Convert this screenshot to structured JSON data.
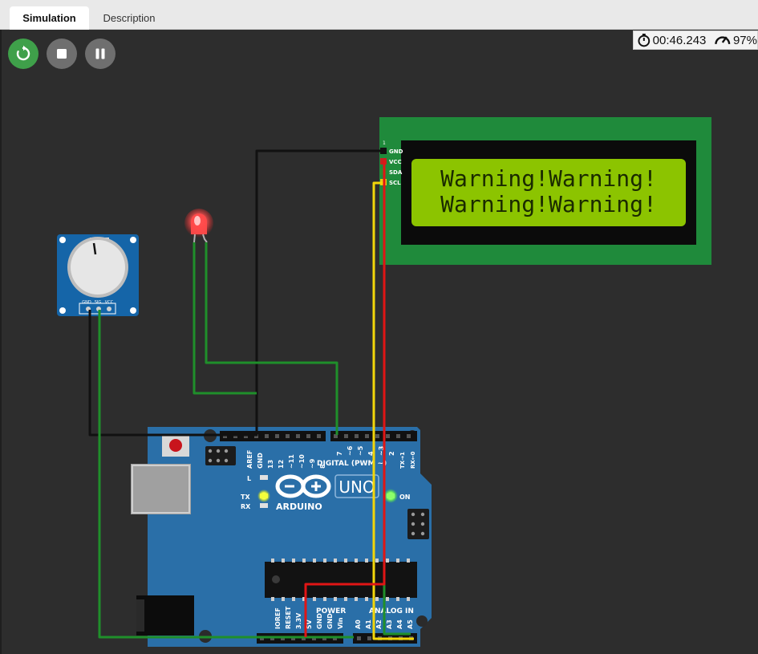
{
  "tabs": [
    {
      "label": "Simulation",
      "active": true
    },
    {
      "label": "Description",
      "active": false
    }
  ],
  "controls": {
    "restart": "restart-icon",
    "stop": "stop-icon",
    "pause": "pause-icon"
  },
  "status": {
    "elapsed_time": "00:46.243",
    "speed": "97%"
  },
  "lcd": {
    "line1": "Warning!Warning!",
    "line2": "Warning!Warning!",
    "pins": [
      "1",
      "GND",
      "VCC",
      "SDA",
      "SCL"
    ],
    "background": "#8cc400",
    "board_color": "#1f8a3b"
  },
  "potentiometer": {
    "pins": [
      "GND",
      "SIG",
      "VCC"
    ],
    "board_color": "#1565a8"
  },
  "led": {
    "color": "#ff3b3b"
  },
  "arduino": {
    "model": "UNO",
    "brand": "ARDUINO",
    "on_label": "ON",
    "l_label": "L",
    "tx_label": "TX",
    "rx_label": "RX",
    "digital_label": "DIGITAL (PWM ~)",
    "digital_pins": [
      "AREF",
      "GND",
      "13",
      "12",
      "~11",
      "~10",
      "~9",
      "8",
      "7",
      "~6",
      "~5",
      "4",
      "~3",
      "2",
      "TX→1",
      "RX←0"
    ],
    "power_label": "POWER",
    "power_pins": [
      "IOREF",
      "RESET",
      "3.3V",
      "5V",
      "GND",
      "GND",
      "Vin"
    ],
    "analog_label": "ANALOG IN",
    "analog_pins": [
      "A0",
      "A1",
      "A2",
      "A3",
      "A4",
      "A5"
    ],
    "board_color": "#2a6fa8"
  },
  "wires": {
    "black": "#111111",
    "green": "#1f8f2a",
    "yellow": "#f2d60a",
    "red": "#e01515"
  }
}
